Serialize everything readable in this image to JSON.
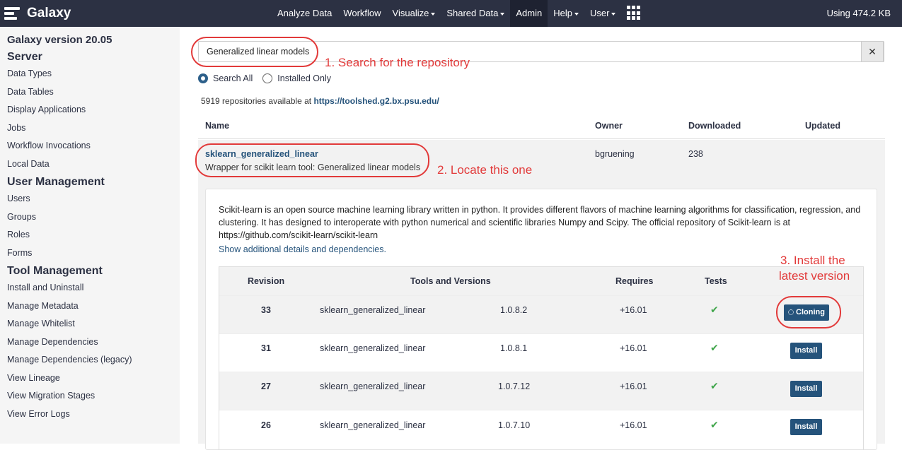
{
  "masthead": {
    "brand": "Galaxy",
    "nav": [
      {
        "label": "Analyze Data",
        "caret": false,
        "active": false
      },
      {
        "label": "Workflow",
        "caret": false,
        "active": false
      },
      {
        "label": "Visualize",
        "caret": true,
        "active": false
      },
      {
        "label": "Shared Data",
        "caret": true,
        "active": false
      },
      {
        "label": "Admin",
        "caret": false,
        "active": true
      },
      {
        "label": "Help",
        "caret": true,
        "active": false
      },
      {
        "label": "User",
        "caret": true,
        "active": false
      }
    ],
    "quota": "Using 474.2 KB"
  },
  "sidebar": {
    "title": "Galaxy version 20.05",
    "sections": [
      {
        "heading": "Server",
        "items": [
          "Data Types",
          "Data Tables",
          "Display Applications",
          "Jobs",
          "Workflow Invocations",
          "Local Data"
        ]
      },
      {
        "heading": "User Management",
        "items": [
          "Users",
          "Groups",
          "Roles",
          "Forms"
        ]
      },
      {
        "heading": "Tool Management",
        "items": [
          "Install and Uninstall",
          "Manage Metadata",
          "Manage Whitelist",
          "Manage Dependencies",
          "Manage Dependencies (legacy)",
          "View Lineage",
          "View Migration Stages",
          "View Error Logs"
        ]
      }
    ]
  },
  "search": {
    "value": "Generalized linear models",
    "clear": "✕"
  },
  "filters": {
    "search_all": "Search All",
    "installed_only": "Installed Only"
  },
  "availability": {
    "text": "5919 repositories available at ",
    "url": "https://toolshed.g2.bx.psu.edu/"
  },
  "table": {
    "headers": {
      "name": "Name",
      "owner": "Owner",
      "downloaded": "Downloaded",
      "updated": "Updated"
    }
  },
  "repo": {
    "name": "sklearn_generalized_linear",
    "description": "Wrapper for scikit learn tool: Generalized linear models",
    "owner": "bgruening",
    "downloaded": "238",
    "long_description": "Scikit-learn is an open source machine learning library written in python. It provides different flavors of machine learning algorithms for classification, regression, and clustering. It has designed to interoperate with python numerical and scientific libraries Numpy and Scipy. The official repository of Scikit-learn is at https://github.com/scikit-learn/scikit-learn",
    "show_more": "Show additional details and dependencies."
  },
  "revisions": {
    "headers": {
      "revision": "Revision",
      "tools": "Tools and Versions",
      "requires": "Requires",
      "tests": "Tests"
    },
    "rows": [
      {
        "revision": "33",
        "tool": "sklearn_generalized_linear",
        "version": "1.0.8.2",
        "requires": "+16.01",
        "tests": "✔",
        "action": "Cloning"
      },
      {
        "revision": "31",
        "tool": "sklearn_generalized_linear",
        "version": "1.0.8.1",
        "requires": "+16.01",
        "tests": "✔",
        "action": "Install"
      },
      {
        "revision": "27",
        "tool": "sklearn_generalized_linear",
        "version": "1.0.7.12",
        "requires": "+16.01",
        "tests": "✔",
        "action": "Install"
      },
      {
        "revision": "26",
        "tool": "sklearn_generalized_linear",
        "version": "1.0.7.10",
        "requires": "+16.01",
        "tests": "✔",
        "action": "Install"
      }
    ]
  },
  "annotations": {
    "step1": "1. Search for the repository",
    "step2": "2. Locate this one",
    "step3_line1": "3. Install the",
    "step3_line2": "latest version",
    "color": "#e23a3a"
  }
}
